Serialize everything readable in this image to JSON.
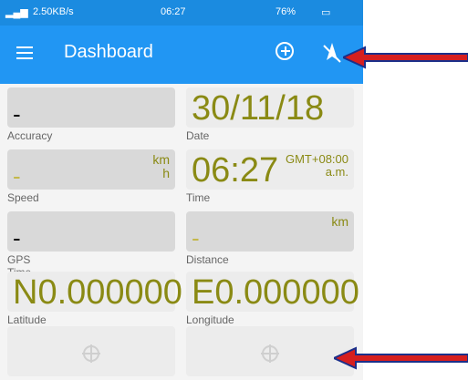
{
  "status_bar": {
    "network_speed": "2.50KB/s",
    "time": "06:27",
    "battery": "76%"
  },
  "app_bar": {
    "title": "Dashboard",
    "icons": [
      "menu-icon",
      "add-circle-icon",
      "gps-off-icon"
    ]
  },
  "tiles": {
    "accuracy": {
      "value": "-",
      "label": "Accuracy"
    },
    "date": {
      "value": "30/11/18",
      "label": "Date"
    },
    "speed": {
      "value": "-",
      "unit_top": "km",
      "unit_bottom": "h",
      "label": "Speed"
    },
    "time": {
      "value": "06:27",
      "tz": "GMT+08:00",
      "ampm": "a.m.",
      "label": "Time"
    },
    "gps_time": {
      "value": "-",
      "label": "GPS Time"
    },
    "distance": {
      "value": "-",
      "unit": "km",
      "label": "Distance"
    },
    "latitude": {
      "value": "N0.000000",
      "label": "Latitude"
    },
    "longitude": {
      "value": "E0.000000",
      "label": "Longitude"
    }
  },
  "colors": {
    "app_bar": "#2196f3",
    "value_text": "#8a8a14",
    "arrow": "#d61f1f"
  }
}
